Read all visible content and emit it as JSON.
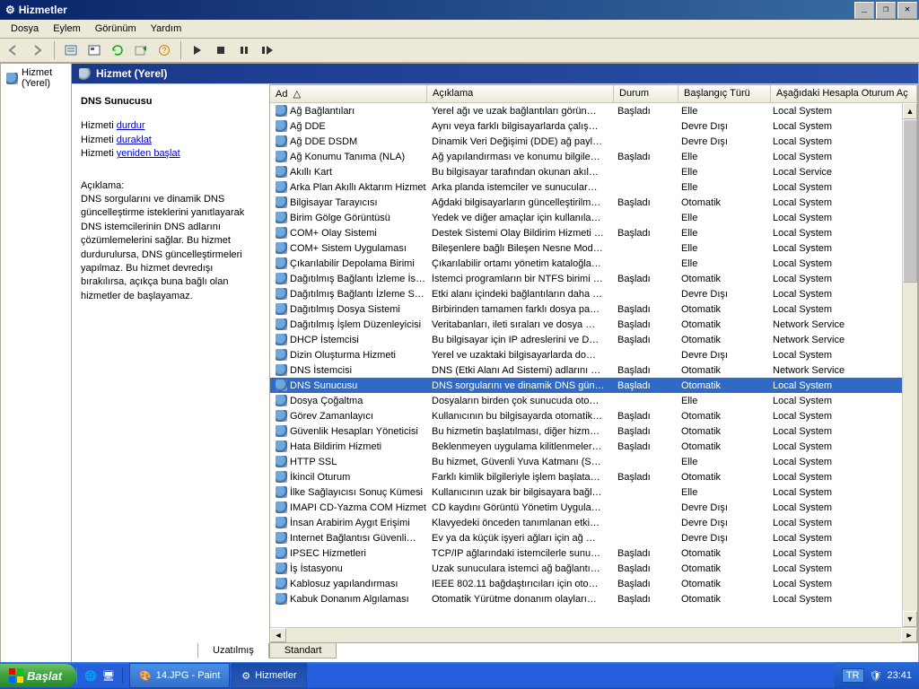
{
  "title": "Hizmetler",
  "menus": [
    "Dosya",
    "Eylem",
    "Görünüm",
    "Yardım"
  ],
  "tree_root": "Hizmet (Yerel)",
  "blue_title": "Hizmet (Yerel)",
  "detail": {
    "svc_name": "DNS Sunucusu",
    "line1_pre": "Hizmeti ",
    "link1": "durdur",
    "line2_pre": "Hizmeti ",
    "link2": "duraklat",
    "line3_pre": "Hizmeti ",
    "link3": "yeniden başlat",
    "expl_label": "Açıklama:",
    "expl_text": "DNS sorgularını ve dinamik DNS güncelleştirme isteklerini yanıtlayarak DNS istemcilerinin DNS adlarını çözümlemelerini sağlar. Bu hizmet durdurulursa, DNS güncelleştirmeleri yapılmaz. Bu hizmet devredışı bırakılırsa, açıkça buna bağlı olan hizmetler de başlayamaz."
  },
  "columns": {
    "name": "Ad",
    "desc": "Açıklama",
    "status": "Durum",
    "startup": "Başlangıç Türü",
    "logon": "Aşağıdaki Hesapla Oturum Aç"
  },
  "tabs": {
    "extended": "Uzatılmış",
    "standard": "Standart"
  },
  "services": [
    {
      "n": "Ağ Bağlantıları",
      "d": "Yerel ağı ve uzak bağlantıları görün…",
      "s": "Başladı",
      "sp": "Elle",
      "l": "Local System"
    },
    {
      "n": "Ağ DDE",
      "d": "Aynı veya farklı bilgisayarlarda çalış…",
      "s": "",
      "sp": "Devre Dışı",
      "l": "Local System"
    },
    {
      "n": "Ağ DDE DSDM",
      "d": "Dinamik Veri Değişimi (DDE) ağ payl…",
      "s": "",
      "sp": "Devre Dışı",
      "l": "Local System"
    },
    {
      "n": "Ağ Konumu Tanıma (NLA)",
      "d": "Ağ yapılandırması ve konumu bilgile…",
      "s": "Başladı",
      "sp": "Elle",
      "l": "Local System"
    },
    {
      "n": "Akıllı Kart",
      "d": "Bu bilgisayar tarafından okunan akıl…",
      "s": "",
      "sp": "Elle",
      "l": "Local Service"
    },
    {
      "n": "Arka Plan Akıllı Aktarım Hizmeti",
      "d": "Arka planda istemciler ve sunucular…",
      "s": "",
      "sp": "Elle",
      "l": "Local System"
    },
    {
      "n": "Bilgisayar Tarayıcısı",
      "d": "Ağdaki bilgisayarların güncelleştirilm…",
      "s": "Başladı",
      "sp": "Otomatik",
      "l": "Local System"
    },
    {
      "n": "Birim Gölge Görüntüsü",
      "d": "Yedek ve diğer amaçlar için kullanıla…",
      "s": "",
      "sp": "Elle",
      "l": "Local System"
    },
    {
      "n": "COM+ Olay Sistemi",
      "d": "Destek Sistemi Olay Bildirim Hizmeti …",
      "s": "Başladı",
      "sp": "Elle",
      "l": "Local System"
    },
    {
      "n": "COM+ Sistem Uygulaması",
      "d": "Bileşenlere bağlı Bileşen Nesne Mod…",
      "s": "",
      "sp": "Elle",
      "l": "Local System"
    },
    {
      "n": "Çıkarılabilir Depolama Birimi",
      "d": "Çıkarılabilir ortamı yönetim kataloğla…",
      "s": "",
      "sp": "Elle",
      "l": "Local System"
    },
    {
      "n": "Dağıtılmış Bağlantı İzleme İs…",
      "d": "İstemci programların bir NTFS birimi …",
      "s": "Başladı",
      "sp": "Otomatik",
      "l": "Local System"
    },
    {
      "n": "Dağıtılmış Bağlantı İzleme S…",
      "d": "Etki alanı içindeki bağlantıların daha …",
      "s": "",
      "sp": "Devre Dışı",
      "l": "Local System"
    },
    {
      "n": "Dağıtılmış Dosya Sistemi",
      "d": "Birbirinden tamamen farklı dosya pa…",
      "s": "Başladı",
      "sp": "Otomatik",
      "l": "Local System"
    },
    {
      "n": "Dağıtılmış İşlem Düzenleyicisi",
      "d": "Veritabanları, ileti sıraları ve dosya …",
      "s": "Başladı",
      "sp": "Otomatik",
      "l": "Network Service"
    },
    {
      "n": "DHCP İstemcisi",
      "d": "Bu bilgisayar için IP adreslerini ve D…",
      "s": "Başladı",
      "sp": "Otomatik",
      "l": "Network Service"
    },
    {
      "n": "Dizin Oluşturma Hizmeti",
      "d": "Yerel ve uzaktaki bilgisayarlarda do…",
      "s": "",
      "sp": "Devre Dışı",
      "l": "Local System"
    },
    {
      "n": "DNS İstemcisi",
      "d": "DNS (Etki Alanı Ad Sistemi) adlarını …",
      "s": "Başladı",
      "sp": "Otomatik",
      "l": "Network Service"
    },
    {
      "n": "DNS Sunucusu",
      "d": "DNS sorgularını ve dinamik DNS gün…",
      "s": "Başladı",
      "sp": "Otomatik",
      "l": "Local System",
      "sel": true
    },
    {
      "n": "Dosya Çoğaltma",
      "d": "Dosyaların birden çok sunucuda oto…",
      "s": "",
      "sp": "Elle",
      "l": "Local System"
    },
    {
      "n": "Görev Zamanlayıcı",
      "d": "Kullanıcının bu bilgisayarda otomatik…",
      "s": "Başladı",
      "sp": "Otomatik",
      "l": "Local System"
    },
    {
      "n": "Güvenlik Hesapları Yöneticisi",
      "d": "Bu hizmetin başlatılması, diğer hizm…",
      "s": "Başladı",
      "sp": "Otomatik",
      "l": "Local System"
    },
    {
      "n": "Hata Bildirim Hizmeti",
      "d": "Beklenmeyen uygulama kilitlenmeler…",
      "s": "Başladı",
      "sp": "Otomatik",
      "l": "Local System"
    },
    {
      "n": "HTTP SSL",
      "d": "Bu hizmet, Güvenli Yuva Katmanı (S…",
      "s": "",
      "sp": "Elle",
      "l": "Local System"
    },
    {
      "n": "İkincil Oturum",
      "d": "Farklı kimlik bilgileriyle işlem başlata…",
      "s": "Başladı",
      "sp": "Otomatik",
      "l": "Local System"
    },
    {
      "n": "İlke Sağlayıcısı Sonuç Kümesi",
      "d": "Kullanıcının uzak bir bilgisayara bağl…",
      "s": "",
      "sp": "Elle",
      "l": "Local System"
    },
    {
      "n": "IMAPI CD-Yazma COM Hizmeti",
      "d": "CD kaydını Görüntü Yönetim Uygula…",
      "s": "",
      "sp": "Devre Dışı",
      "l": "Local System"
    },
    {
      "n": "İnsan Arabirim Aygıt Erişimi",
      "d": "Klavyedeki önceden tanımlanan etki…",
      "s": "",
      "sp": "Devre Dışı",
      "l": "Local System"
    },
    {
      "n": "Internet Bağlantısı Güvenli…",
      "d": "Ev ya da küçük işyeri ağları için ağ …",
      "s": "",
      "sp": "Devre Dışı",
      "l": "Local System"
    },
    {
      "n": "IPSEC Hizmetleri",
      "d": "TCP/IP ağlarındaki istemcilerle sunu…",
      "s": "Başladı",
      "sp": "Otomatik",
      "l": "Local System"
    },
    {
      "n": "İş İstasyonu",
      "d": "Uzak sunuculara istemci ağ bağlantı…",
      "s": "Başladı",
      "sp": "Otomatik",
      "l": "Local System"
    },
    {
      "n": "Kablosuz yapılandırması",
      "d": "IEEE 802.11 bağdaştırıcıları için oto…",
      "s": "Başladı",
      "sp": "Otomatik",
      "l": "Local System"
    },
    {
      "n": "Kabuk Donanım Algılaması",
      "d": "Otomatik Yürütme donanım olayları…",
      "s": "Başladı",
      "sp": "Otomatik",
      "l": "Local System"
    }
  ],
  "taskbar": {
    "start": "Başlat",
    "task1": "14.JPG - Paint",
    "task2": "Hizmetler",
    "lang": "TR",
    "clock": "23:41"
  }
}
